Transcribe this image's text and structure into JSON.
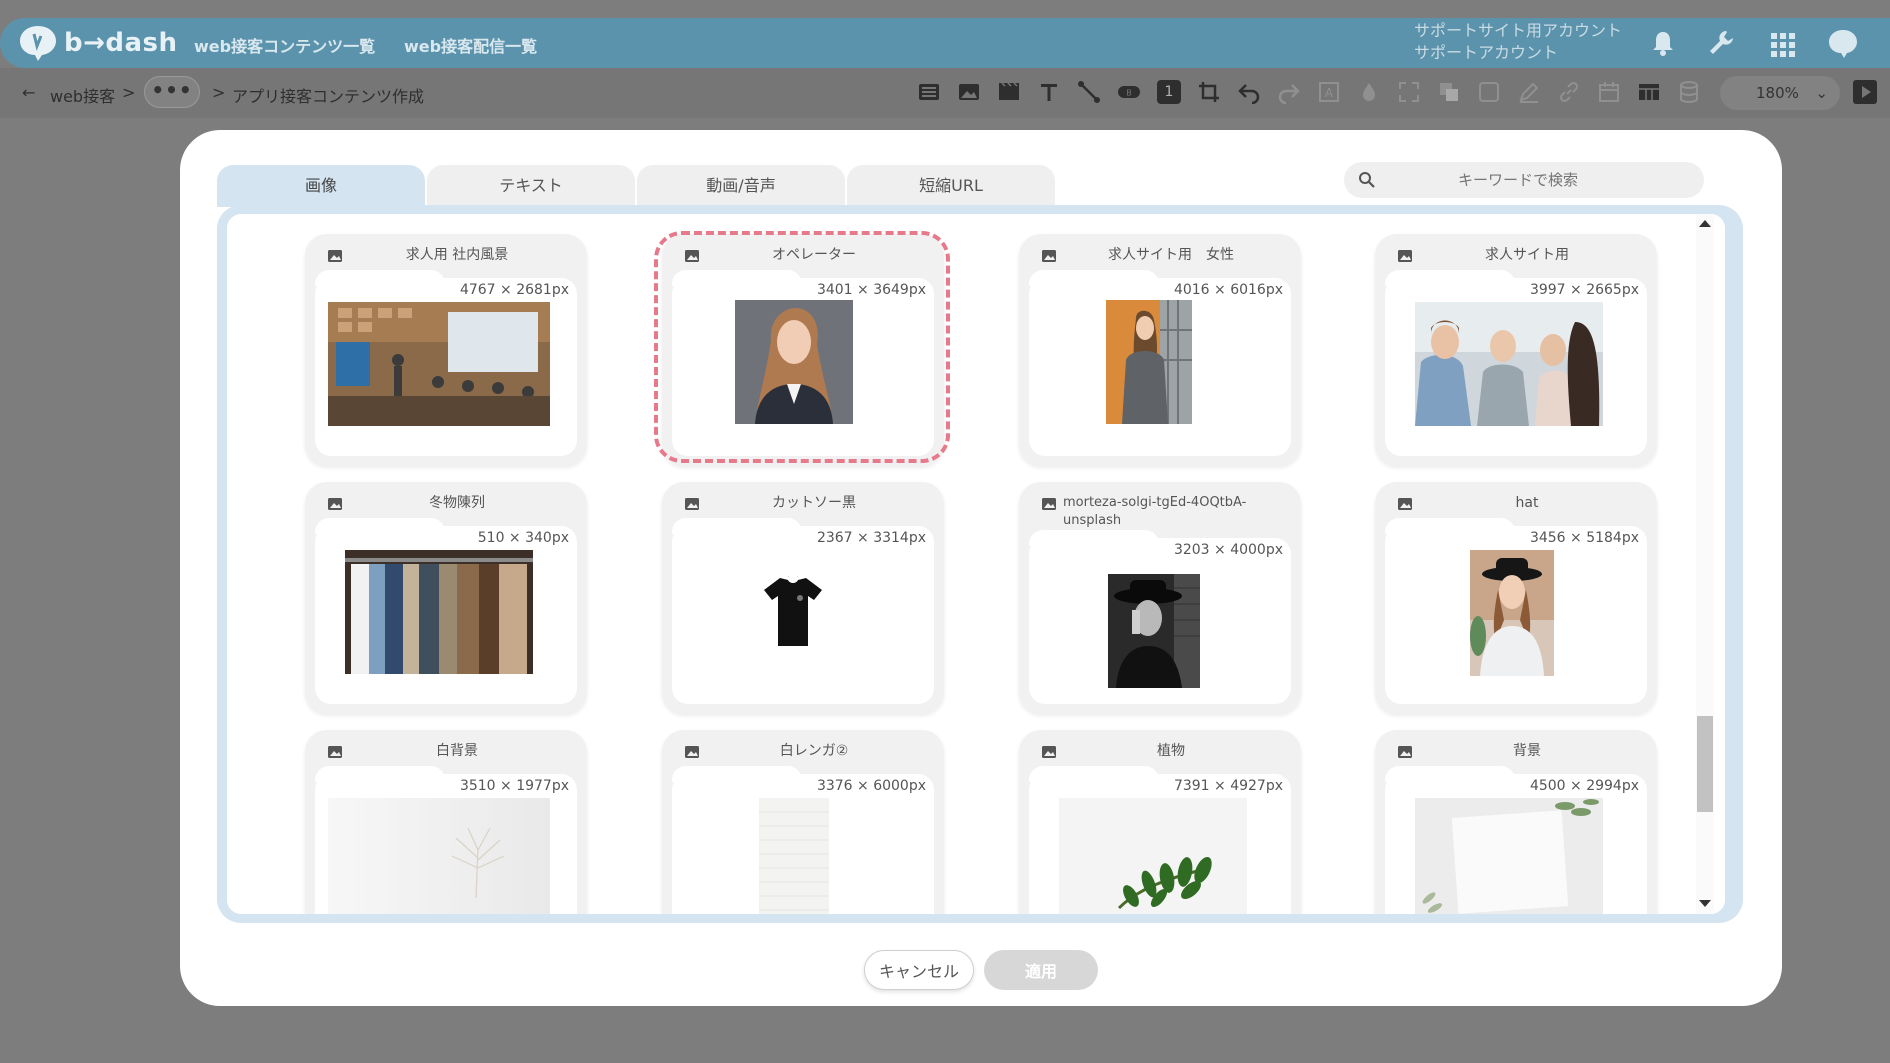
{
  "header": {
    "logo_text": "b→dash",
    "nav": [
      "web接客コンテンツ一覧",
      "web接客配信一覧"
    ],
    "account_line1": "サポートサイト用アカウント",
    "account_line2": "サポートアカウント"
  },
  "breadcrumb": {
    "back_label": "web接客",
    "sep1": ">",
    "more_label": "•••",
    "sep2": ">",
    "current": "アプリ接客コンテンツ作成"
  },
  "toolbar": {
    "zoom": "180%",
    "number_badge": "1"
  },
  "modal": {
    "tabs": [
      "画像",
      "テキスト",
      "動画/音声",
      "短縮URL"
    ],
    "search_placeholder": "キーワードで検索",
    "cancel_label": "キャンセル",
    "apply_label": "適用"
  },
  "images": [
    {
      "title": "求人用 社内風景",
      "dims": "4767 × 2681px"
    },
    {
      "title": "オペレーター",
      "dims": "3401 × 3649px"
    },
    {
      "title": "求人サイト用　女性",
      "dims": "4016 × 6016px"
    },
    {
      "title": "求人サイト用",
      "dims": "3997 × 2665px"
    },
    {
      "title": "冬物陳列",
      "dims": "510 × 340px"
    },
    {
      "title": "カットソー黒",
      "dims": "2367 × 3314px"
    },
    {
      "title": "morteza-solgi-tgEd-4OQtbA-unsplash",
      "dims": "3203 × 4000px"
    },
    {
      "title": "hat",
      "dims": "3456 × 5184px"
    },
    {
      "title": "白背景",
      "dims": "3510 × 1977px"
    },
    {
      "title": "白レンガ②",
      "dims": "3376 × 6000px"
    },
    {
      "title": "植物",
      "dims": "7391 × 4927px"
    },
    {
      "title": "背景",
      "dims": "4500 × 2994px"
    }
  ],
  "selected_index": 1,
  "colors": {
    "header_bg": "#5b93ad",
    "tab_active": "#d4e4f1",
    "selection_dash": "#e6798a",
    "overlay": "#7d7d7d"
  }
}
